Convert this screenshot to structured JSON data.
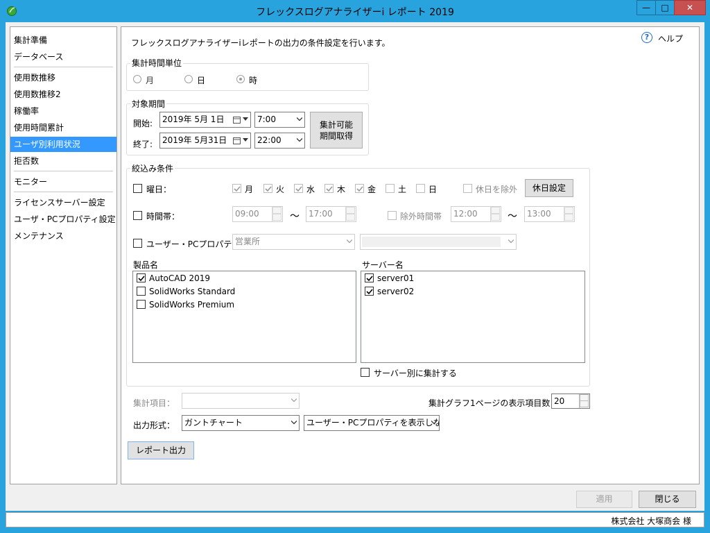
{
  "window": {
    "title": "フレックスログアナライザーi レポート 2019",
    "min": "—",
    "max": "□",
    "close": "✕"
  },
  "sidebar": {
    "items": [
      "集計準備",
      "データベース",
      "使用数推移",
      "使用数推移2",
      "稼働率",
      "使用時間累計",
      "ユーザ別利用状況",
      "拒否数",
      "モニター",
      "ライセンスサーバー設定",
      "ユーザ・PCプロパティ設定",
      "メンテナンス"
    ],
    "selected": "ユーザ別利用状況"
  },
  "header": {
    "description": "フレックスログアナライザーiレポートの出力の条件設定を行います。",
    "help": "ヘルプ"
  },
  "unit": {
    "title": "集計時間単位",
    "options": [
      "月",
      "日",
      "時"
    ],
    "selected": "時"
  },
  "period": {
    "title": "対象期間",
    "start_label": "開始:",
    "start_date": "2019年  5月  1日",
    "start_time": "7:00",
    "end_label": "終了:",
    "end_date": "2019年  5月31日",
    "end_time": "22:00",
    "fetch_button": [
      "集計可能",
      "期間取得"
    ]
  },
  "filter": {
    "title": "絞込み条件",
    "weekday": {
      "label": "曜日：",
      "days": [
        {
          "label": "月",
          "checked": true
        },
        {
          "label": "火",
          "checked": true
        },
        {
          "label": "水",
          "checked": true
        },
        {
          "label": "木",
          "checked": true
        },
        {
          "label": "金",
          "checked": true
        },
        {
          "label": "土",
          "checked": false
        },
        {
          "label": "日",
          "checked": false
        }
      ],
      "exclude_holiday": "休日を除外",
      "holiday_button": "休日設定"
    },
    "time": {
      "label": "時間帯：",
      "from": "09:00",
      "to": "17:00",
      "tilde": "～",
      "exclude_label": "除外時間帯",
      "ex_from": "12:00",
      "ex_to": "13:00"
    },
    "property": {
      "label": "ユーザー・PCプロパティ：",
      "value": "営業所",
      "value2": ""
    },
    "products": {
      "title": "製品名",
      "items": [
        {
          "label": "AutoCAD 2019",
          "checked": true
        },
        {
          "label": "SolidWorks Standard",
          "checked": false
        },
        {
          "label": "SolidWorks Premium",
          "checked": false
        }
      ]
    },
    "servers": {
      "title": "サーバー名",
      "items": [
        {
          "label": "server01",
          "checked": true
        },
        {
          "label": "server02",
          "checked": true
        }
      ]
    },
    "per_server": "サーバー別に集計する"
  },
  "output": {
    "item_label": "集計項目：",
    "item_value": "",
    "graph_label": "集計グラフ1ページの表示項目数：",
    "graph_count": "20",
    "format_label": "出力形式：",
    "format_value": "ガントチャート",
    "property_display": "ユーザー・PCプロパティを表示しない",
    "report_button": "レポート出力"
  },
  "footer": {
    "apply": "適用",
    "close": "閉じる",
    "status": "株式会社 大塚商会 様"
  }
}
